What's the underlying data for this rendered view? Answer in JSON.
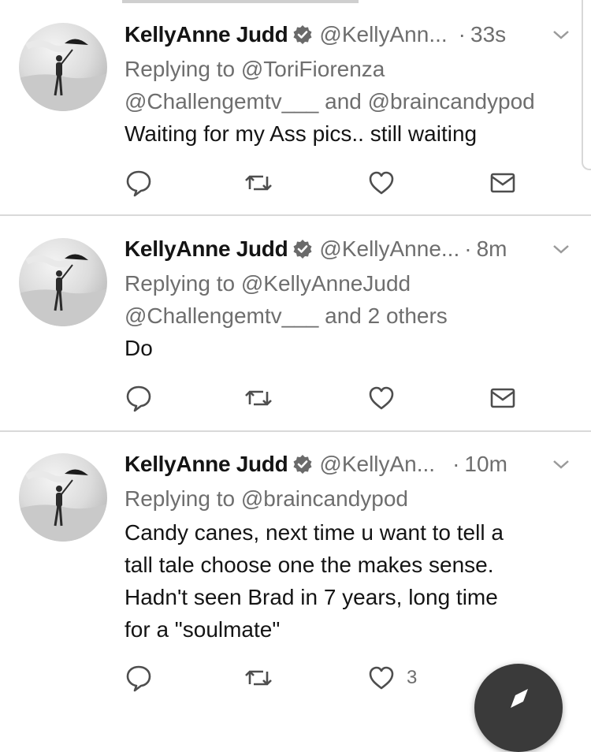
{
  "colors": {
    "name": "#141414",
    "muted": "#6e6e6e",
    "divider": "#d9d9d9",
    "fab": "#3a3a3a"
  },
  "icons": {
    "verified": "verified-badge-icon",
    "menu": "chevron-down-icon",
    "reply": "reply-icon",
    "retweet": "retweet-icon",
    "like": "heart-icon",
    "dm": "mail-icon",
    "compose": "compose-icon"
  },
  "tweets": [
    {
      "name": "KellyAnne Judd",
      "handle": "@KellyAnn...",
      "dot": "·",
      "time": "33s",
      "reply_prefix": "Replying to",
      "reply_line1_mentions": "@ToriFiorenza",
      "reply_line2": "@Challengemtv___ and @braincandypod",
      "text_lines": [
        "Waiting for my Ass pics..   still waiting"
      ],
      "like_count": ""
    },
    {
      "name": "KellyAnne Judd",
      "handle": "@KellyAnne...",
      "dot": "·",
      "time": "8m",
      "reply_prefix": "Replying to",
      "reply_line1_mentions": "@KellyAnneJudd",
      "reply_line2": "@Challengemtv___ and 2 others",
      "text_lines": [
        "Do"
      ],
      "like_count": ""
    },
    {
      "name": "KellyAnne Judd",
      "handle": "@KellyAn...",
      "dot": "·",
      "time": "10m",
      "reply_prefix": "Replying to",
      "reply_line1_mentions": "@braincandypod",
      "reply_line2": "",
      "text_lines": [
        "Candy canes, next time u want to tell a",
        "tall tale choose one the makes sense.",
        "Hadn't seen Brad in 7 years, long time",
        "for a \"soulmate\""
      ],
      "like_count": "3"
    }
  ]
}
